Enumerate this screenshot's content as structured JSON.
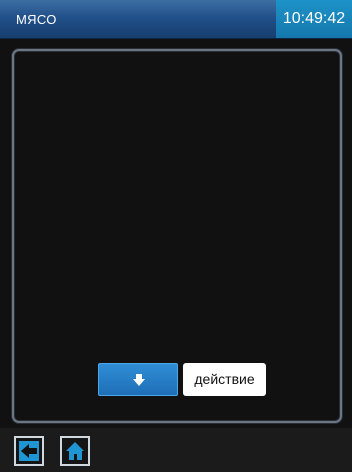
{
  "header": {
    "title": "МЯСО",
    "time": "10:49:42"
  },
  "controls": {
    "down_icon": "arrow-down-icon",
    "action_label": "действие"
  },
  "footer": {
    "back_icon": "arrow-left-icon",
    "home_icon": "home-icon"
  },
  "colors": {
    "header_blue": "#22508a",
    "accent_blue": "#1f96d3",
    "button_blue": "#1f6fb6",
    "panel_border": "#6c7786"
  }
}
